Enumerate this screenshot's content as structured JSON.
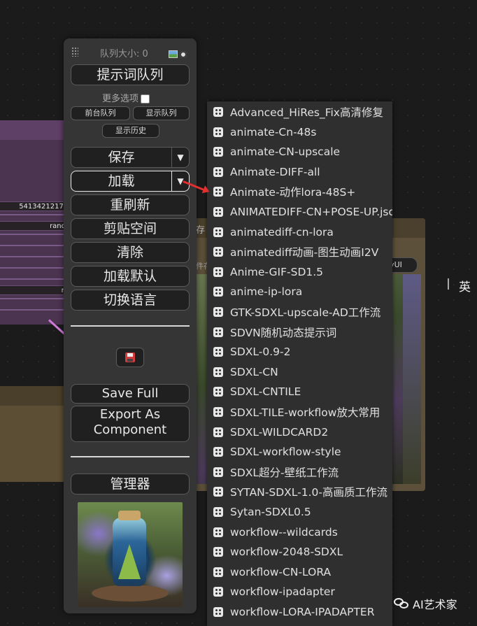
{
  "background": {
    "left_node_values": [
      "5413421217’",
      "rand",
      "n"
    ],
    "right_node_fragment": "存",
    "right_node_fragment2": "件存",
    "right_node_pill": "yUI",
    "right_edge_char": "英"
  },
  "panel": {
    "queue_size_label": "队列大小: 0",
    "prompt_queue_button": "提示词队列",
    "more_options_label": "更多选项",
    "more_options_checked": false,
    "front_queue_button": "前台队列",
    "show_queue_button": "显示队列",
    "show_history_button": "显示历史",
    "save_button": "保存",
    "load_button": "加载",
    "refresh_button": "重刷新",
    "clipspace_button": "剪贴空间",
    "clear_button": "清除",
    "load_default_button": "加载默认",
    "switch_language_button": "切换语言",
    "save_full_button": "Save Full",
    "export_component_line1": "Export As",
    "export_component_line2": "Component",
    "manager_button": "管理器",
    "dropdown_arrow": "▼"
  },
  "workflow_list": [
    "Advanced_HiRes_Fix高清修复",
    "animate-Cn-48s",
    "animate-CN-upscale",
    "Animate-DIFF-all",
    "Animate-动作lora-48S+",
    "ANIMATEDIFF-CN+POSE-UP.json",
    "animatediff-cn-lora",
    "animatediff动画-图生动画I2V",
    "Anime-GIF-SD1.5",
    "anime-ip-lora",
    "GTK-SDXL-upscale-AD工作流",
    "SDVN随机动态提示词",
    "SDXL-0.9-2",
    "SDXL-CN",
    "SDXL-CNTILE",
    "SDXL-TILE-workflow放大常用",
    "SDXL-WILDCARD2",
    "SDXL-workflow-style",
    "SDXL超分-壁纸工作流",
    "SYTAN-SDXL-1.0-高画质工作流",
    "Sytan-SDXL0.5",
    "workflow--wildcards",
    "workflow-2048-SDXL",
    "workflow-CN-LORA",
    "workflow-ipadapter",
    "workflow-LORA-IPADAPTER"
  ],
  "watermark": "AI艺术家",
  "colors": {
    "panel_bg": "#353535",
    "button_bg": "#202020",
    "dropdown_bg": "#2f2f2f",
    "arrow_red": "#e03030"
  }
}
